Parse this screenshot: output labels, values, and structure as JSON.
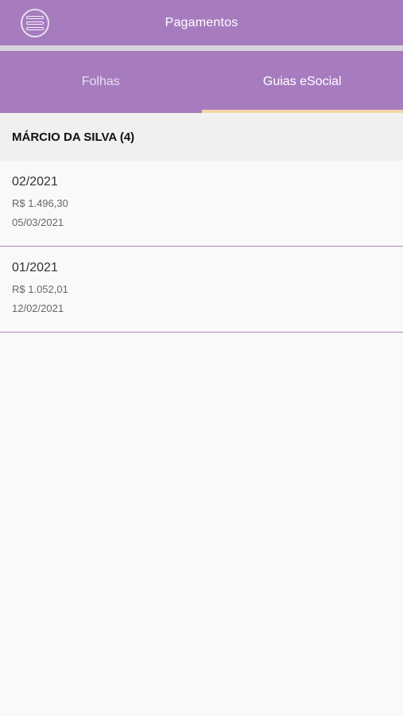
{
  "header": {
    "title": "Pagamentos",
    "menu_icon": "menu-icon"
  },
  "tabs": [
    {
      "label": "Folhas",
      "active": false
    },
    {
      "label": "Guias eSocial",
      "active": true
    }
  ],
  "group": {
    "title": "MÁRCIO DA SILVA (4)"
  },
  "items": [
    {
      "period": "02/2021",
      "amount": "R$ 1.496,30",
      "date": "05/03/2021"
    },
    {
      "period": "01/2021",
      "amount": "R$ 1.052,01",
      "date": "12/02/2021"
    }
  ],
  "colors": {
    "primary": "#a67cbf",
    "tab_indicator": "#f6d6a6",
    "divider": "#a688b5"
  }
}
